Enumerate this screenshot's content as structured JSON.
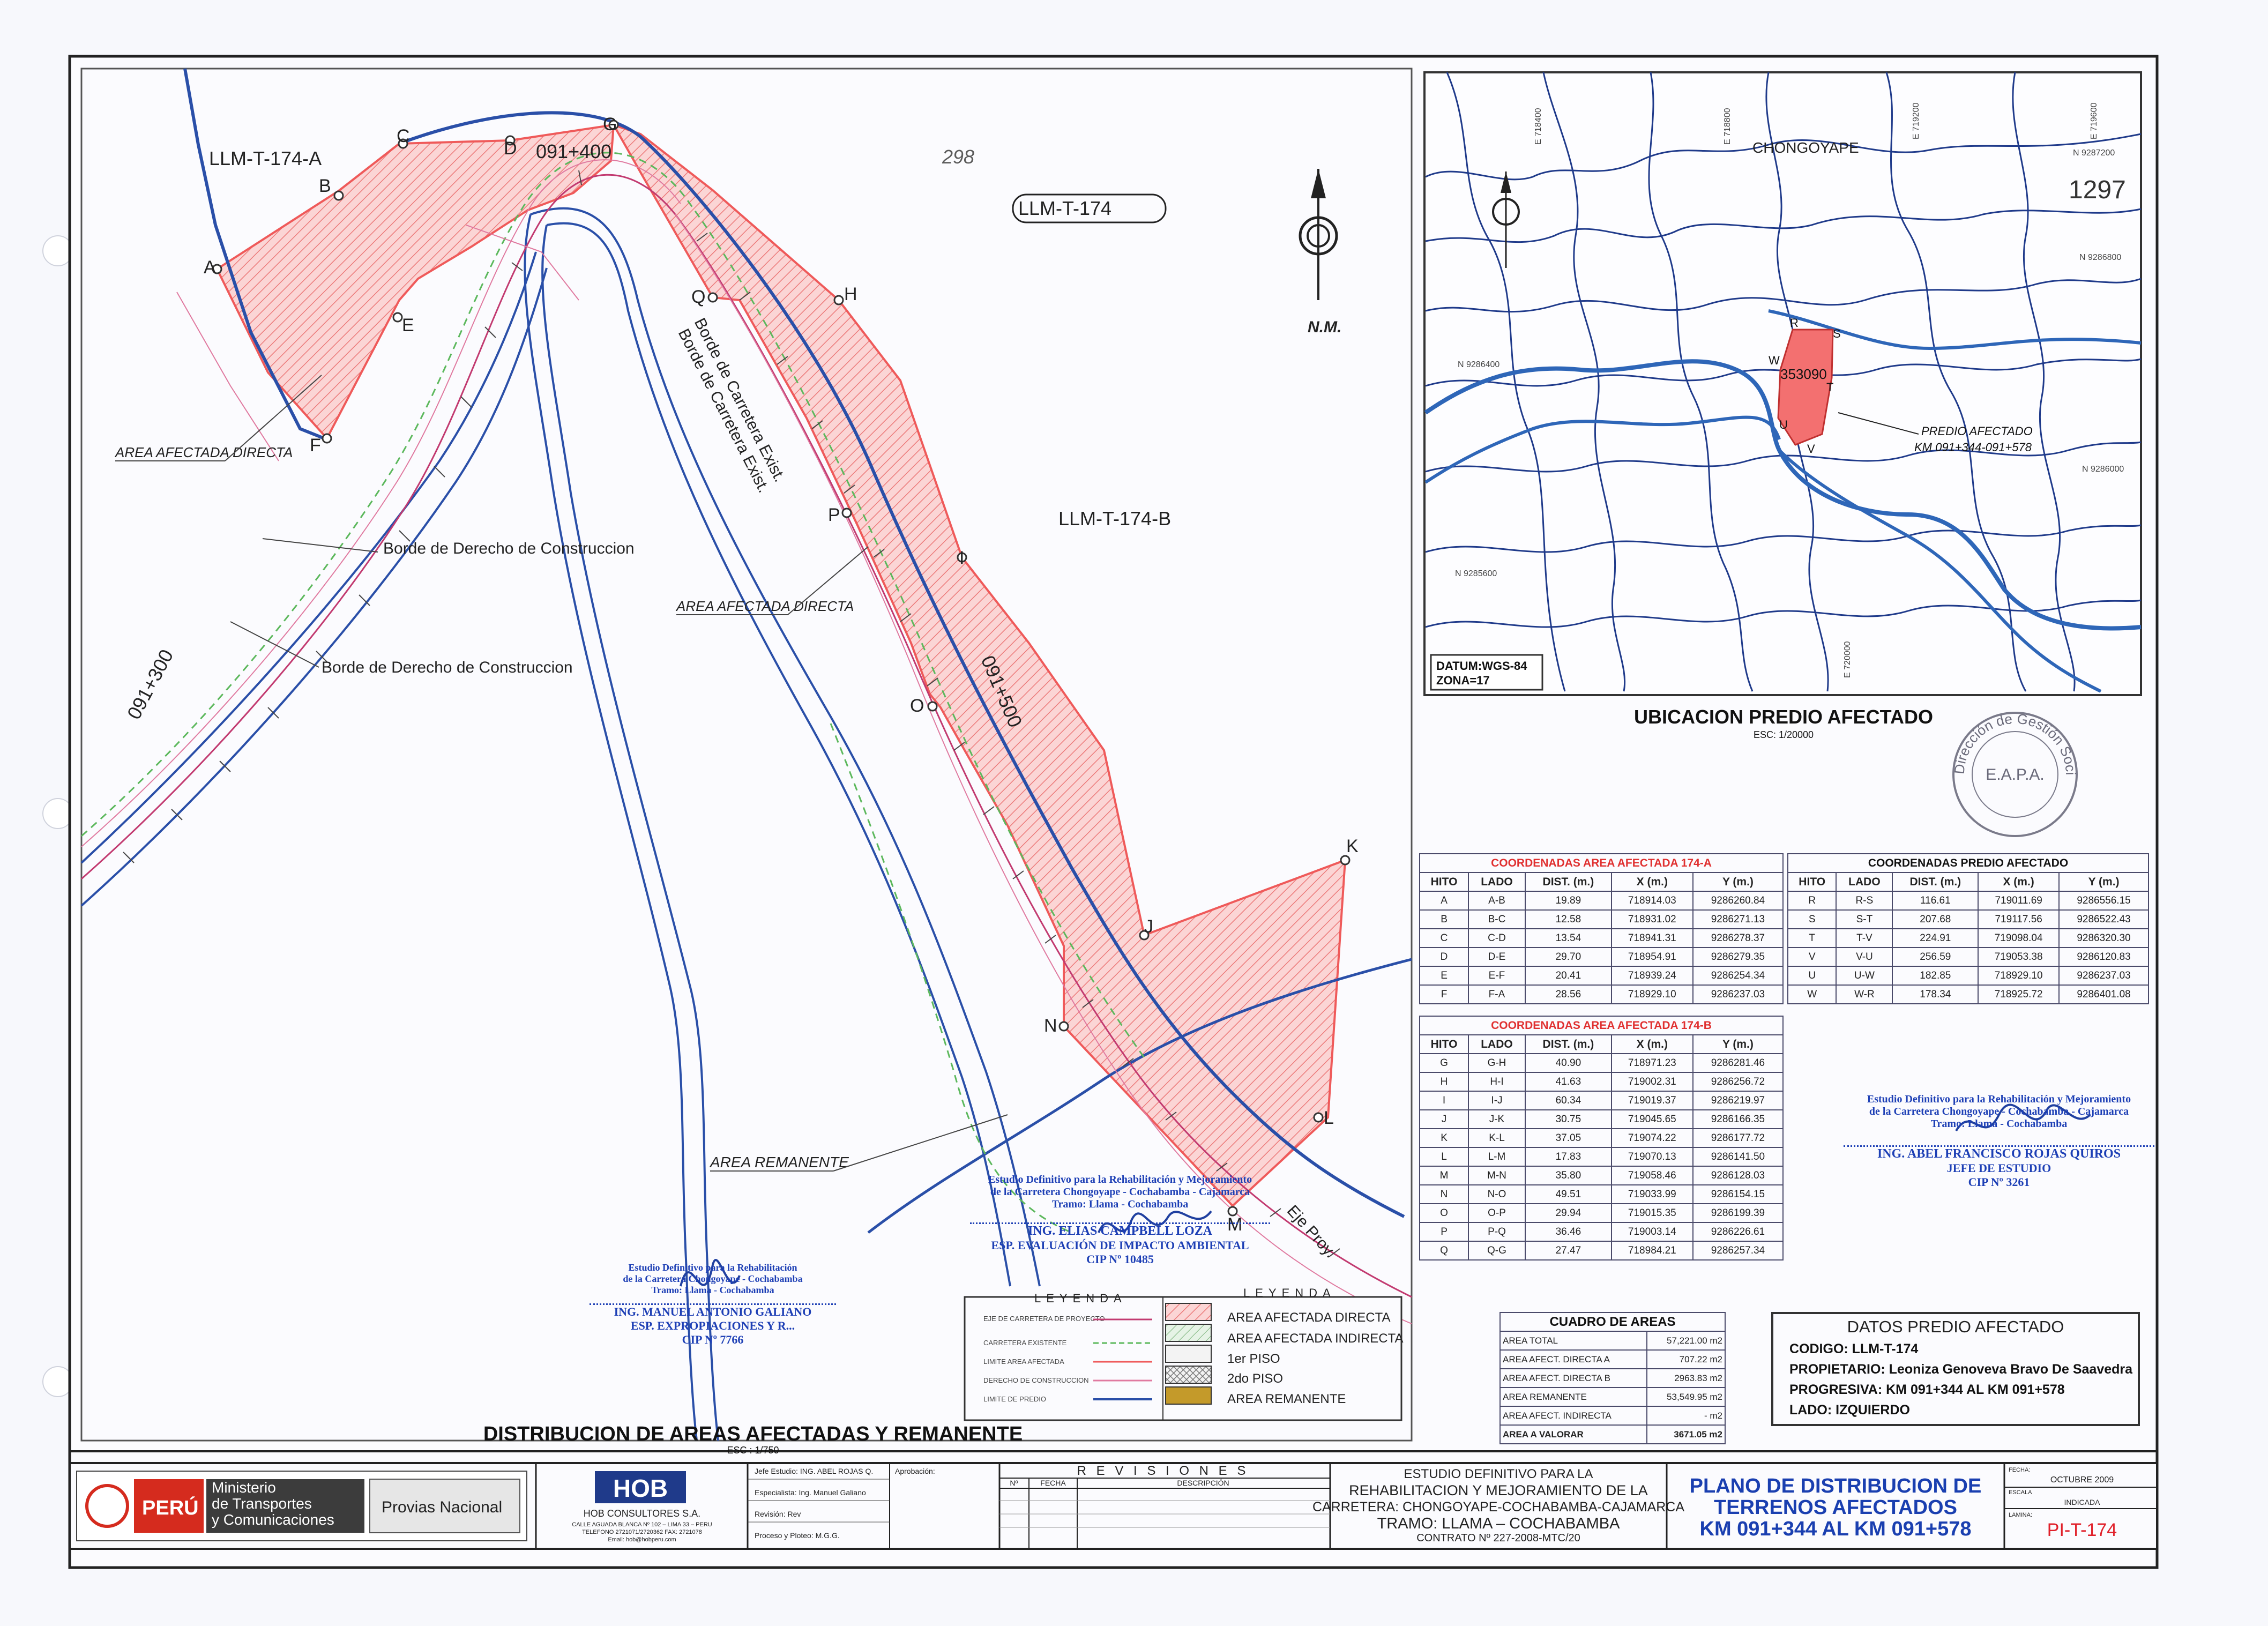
{
  "sheet": {
    "main_title": "DISTRIBUCION DE AREAS AFECTADAS Y REMANENTE",
    "main_scale": "ESC : 1/750",
    "location_title": "UBICACION PREDIO AFECTADO",
    "location_scale": "ESC: 1/20000",
    "north_label": "N.M.",
    "corner_number": "1297",
    "handwritten_number": "298"
  },
  "map": {
    "lot_label": "LLM-T-174",
    "area_a": "LLM-T-174-A",
    "area_b": "LLM-T-174-B",
    "km_labels": [
      "091+300",
      "091+400",
      "091+500"
    ],
    "hitos_a": [
      "A",
      "B",
      "C",
      "D",
      "E",
      "F"
    ],
    "hitos_b": [
      "G",
      "H",
      "I",
      "J",
      "K",
      "L",
      "M",
      "N",
      "O",
      "P",
      "Q"
    ],
    "label_borde_carretera_1": "Borde de Carretera Exist.",
    "label_borde_carretera_2": "Borde de Carretera Exist.",
    "label_borde_derecho_1": "Borde de Derecho de Construccion",
    "label_borde_derecho_2": "Borde de Derecho de Construccion",
    "label_area_directa_1": "AREA AFECTADA DIRECTA",
    "label_area_directa_2": "AREA AFECTADA DIRECTA",
    "label_area_remanente": "AREA REMANENTE",
    "label_eje": "Eje Proy."
  },
  "location_map": {
    "town": "CHONGOYAPE",
    "datum_line1": "DATUM:WGS-84",
    "datum_line2": "ZONA=17",
    "predio_label_1": "PREDIO AFECTADO",
    "predio_label_2": "KM 091+344-091+578",
    "parcel_code": "353090",
    "vertices": [
      "R",
      "S",
      "T",
      "V",
      "U",
      "W"
    ],
    "north_coords": [
      "N 9287200",
      "N 9286800",
      "N 9286400",
      "N 9286000",
      "N 9285600"
    ],
    "east_coords": [
      "E 718400",
      "E 718800",
      "E 719200",
      "E 719600",
      "E 720000"
    ]
  },
  "tables": {
    "coord_a": {
      "title": "COORDENADAS AREA AFECTADA 174-A",
      "headers": [
        "HITO",
        "LADO",
        "DIST. (m.)",
        "X (m.)",
        "Y (m.)"
      ],
      "rows": [
        [
          "A",
          "A-B",
          "19.89",
          "718914.03",
          "9286260.84"
        ],
        [
          "B",
          "B-C",
          "12.58",
          "718931.02",
          "9286271.13"
        ],
        [
          "C",
          "C-D",
          "13.54",
          "718941.31",
          "9286278.37"
        ],
        [
          "D",
          "D-E",
          "29.70",
          "718954.91",
          "9286279.35"
        ],
        [
          "E",
          "E-F",
          "20.41",
          "718939.24",
          "9286254.34"
        ],
        [
          "F",
          "F-A",
          "28.56",
          "718929.10",
          "9286237.03"
        ]
      ]
    },
    "coord_b": {
      "title": "COORDENADAS AREA AFECTADA 174-B",
      "headers": [
        "HITO",
        "LADO",
        "DIST. (m.)",
        "X (m.)",
        "Y (m.)"
      ],
      "rows": [
        [
          "G",
          "G-H",
          "40.90",
          "718971.23",
          "9286281.46"
        ],
        [
          "H",
          "H-I",
          "41.63",
          "719002.31",
          "9286256.72"
        ],
        [
          "I",
          "I-J",
          "60.34",
          "719019.37",
          "9286219.97"
        ],
        [
          "J",
          "J-K",
          "30.75",
          "719045.65",
          "9286166.35"
        ],
        [
          "K",
          "K-L",
          "37.05",
          "719074.22",
          "9286177.72"
        ],
        [
          "L",
          "L-M",
          "17.83",
          "719070.13",
          "9286141.50"
        ],
        [
          "M",
          "M-N",
          "35.80",
          "719058.46",
          "9286128.03"
        ],
        [
          "N",
          "N-O",
          "49.51",
          "719033.99",
          "9286154.15"
        ],
        [
          "O",
          "O-P",
          "29.94",
          "719015.35",
          "9286199.39"
        ],
        [
          "P",
          "P-Q",
          "36.46",
          "719003.14",
          "9286226.61"
        ],
        [
          "Q",
          "Q-G",
          "27.47",
          "718984.21",
          "9286257.34"
        ]
      ]
    },
    "coord_predio": {
      "title": "COORDENADAS PREDIO AFECTADO",
      "headers": [
        "HITO",
        "LADO",
        "DIST. (m.)",
        "X (m.)",
        "Y (m.)"
      ],
      "rows": [
        [
          "R",
          "R-S",
          "116.61",
          "719011.69",
          "9286556.15"
        ],
        [
          "S",
          "S-T",
          "207.68",
          "719117.56",
          "9286522.43"
        ],
        [
          "T",
          "T-V",
          "224.91",
          "719098.04",
          "9286320.30"
        ],
        [
          "V",
          "V-U",
          "256.59",
          "719053.38",
          "9286120.83"
        ],
        [
          "U",
          "U-W",
          "182.85",
          "718929.10",
          "9286237.03"
        ],
        [
          "W",
          "W-R",
          "178.34",
          "718925.72",
          "9286401.08"
        ]
      ]
    },
    "areas": {
      "title": "CUADRO DE AREAS",
      "rows": [
        [
          "AREA TOTAL",
          "57,221.00  m2"
        ],
        [
          "AREA AFECT. DIRECTA A",
          "707.22  m2"
        ],
        [
          "AREA AFECT. DIRECTA B",
          "2963.83  m2"
        ],
        [
          "AREA REMANENTE",
          "53,549.95  m2"
        ],
        [
          "AREA AFECT. INDIRECTA",
          "-  m2"
        ],
        [
          "AREA A VALORAR",
          "3671.05  m2"
        ]
      ]
    }
  },
  "datos_predio": {
    "title": "DATOS PREDIO AFECTADO",
    "codigo": "CODIGO: LLM-T-174",
    "propietario": "PROPIETARIO: Leoniza Genoveva Bravo De Saavedra",
    "progresiva": "PROGRESIVA: KM 091+344 AL KM 091+578",
    "lado": "LADO: IZQUIERDO"
  },
  "legend": {
    "title": "LEYENDA",
    "lines": [
      "EJE DE CARRETERA DE PROYECTO",
      "CARRETERA EXISTENTE",
      "LIMITE AREA AFECTADA",
      "DERECHO DE CONSTRUCCION",
      "LIMITE DE PREDIO"
    ],
    "fills": [
      "AREA AFECTADA DIRECTA",
      "AREA AFECTADA INDIRECTA",
      "1er PISO",
      "2do PISO",
      "AREA REMANENTE"
    ]
  },
  "stamps": {
    "elias_line1": "Estudio Definitivo para la Rehabilitación y Mejoramiento",
    "elias_line2": "de la Carretera Chongoyape - Cochabamba - Cajamarca",
    "elias_line3": "Tramo: Llama - Cochabamba",
    "elias_name": "ING. ELIAS CAMPBELL LOZA",
    "elias_role": "ESP. EVALUACIÓN DE IMPACTO AMBIENTAL",
    "elias_cip": "CIP Nº 10485",
    "manuel_line1": "Estudio Definitivo para la Rehabilitación",
    "manuel_line2": "de la Carretera Chongoyape - Cochabamba",
    "manuel_line3": "Tramo: Llama - Cochabamba",
    "manuel_name": "ING. MANUEL ANTONIO GALIANO",
    "manuel_role": "ESP. EXPROPIACIONES Y R...",
    "manuel_cip": "CIP Nº 7766",
    "abel_line1": "Estudio Definitivo para la Rehabilitación y Mejoramiento",
    "abel_line2": "de la Carretera Chongoyape - Cochabamba - Cajamarca",
    "abel_line3": "Tramo: Llama - Cochabamba",
    "abel_name": "ING. ABEL FRANCISCO ROJAS QUIROS",
    "abel_role": "JEFE DE ESTUDIO",
    "abel_cip": "CIP Nº 3261",
    "seal_text": "Dirección de Gestión Social",
    "seal_center": "E.A.P.A."
  },
  "title_block": {
    "peru": "PERÚ",
    "ministerio_1": "Ministerio",
    "ministerio_2": "de Transportes",
    "ministerio_3": "y Comunicaciones",
    "provias": "Provias Nacional",
    "hob_logo": "HOB",
    "hob_name": "HOB CONSULTORES S.A.",
    "hob_addr": "CALLE AGUADA BLANCA Nº 102 – LIMA 33 – PERU",
    "hob_phone": "TELEFONO 2721071/2720362 FAX: 2721078",
    "hob_email": "Email: hob@hobperu.com",
    "jefe": "Jefe Estudio: ING. ABEL ROJAS Q.",
    "especialista": "Especialista: Ing. Manuel Galiano",
    "revision": "Revisión: Rev",
    "proceso": "Proceso y Ploteo: M.G.G.",
    "aprobacion": "Aprobación:",
    "revisiones": "R E V I S I O N E S",
    "rev_no": "Nº",
    "rev_fecha": "FECHA",
    "rev_desc": "DESCRIPCIÓN",
    "estudio_1": "ESTUDIO DEFINITIVO PARA LA",
    "estudio_2": "REHABILITACION Y MEJORAMIENTO DE LA",
    "estudio_3": "CARRETERA: CHONGOYAPE-COCHABAMBA-CAJAMARCA",
    "estudio_4": "TRAMO: LLAMA – COCHABAMBA",
    "contrato": "CONTRATO Nº 227-2008-MTC/20",
    "plano_1": "PLANO DE DISTRIBUCION DE",
    "plano_2": "TERRENOS AFECTADOS",
    "plano_3": "KM 091+344 AL KM 091+578",
    "fecha_label": "FECHA:",
    "fecha_value": "OCTUBRE 2009",
    "escala_label": "ESCALA",
    "escala_value": "INDICADA",
    "lamina_label": "LAMINA:",
    "lamina_value": "PI-T-174"
  },
  "colors": {
    "affected": "#f08080",
    "road": "#2a4fa8",
    "border": "#333333",
    "title": "#1a3fb0",
    "lamina": "#e0202a"
  }
}
